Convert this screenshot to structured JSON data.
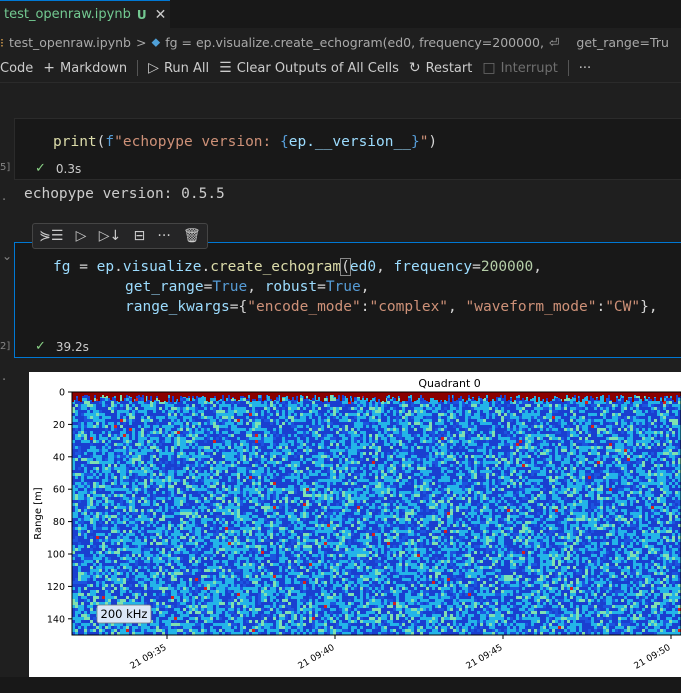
{
  "tab": {
    "name": "test_openraw.ipynb",
    "badge": "U",
    "close": "✕"
  },
  "breadcrumb": {
    "file": "test_openraw.ipynb",
    "sep1": ">",
    "cell": "fg = ep.visualize.create_echogram(ed0, frequency=200000,",
    "wrap": "⏎",
    "rest": "get_range=Tru"
  },
  "toolbar": {
    "code": "Code",
    "markdown": "Markdown",
    "run_all": "Run All",
    "clear": "Clear Outputs of All Cells",
    "restart": "Restart",
    "interrupt": "Interrupt",
    "more": "···"
  },
  "cell1": {
    "gutter": "5]",
    "code_fn": "print",
    "code_p1": "(",
    "code_fprefix": "f",
    "code_str1": "\"echopype version: ",
    "code_brace_open": "{",
    "code_var": "ep.__version__",
    "code_brace_close": "}",
    "code_str2": "\"",
    "code_p2": ")",
    "time": "0.3s",
    "output": "echopype version: 0.5.5",
    "out_gutter": "."
  },
  "cell2": {
    "gutter": "2]",
    "chevron": "⌄",
    "time": "39.2s",
    "out_gutter": ".",
    "line1_var1": "fg",
    "line1_eq": " = ",
    "line1_obj": "ep",
    "line1_dot1": ".",
    "line1_mod": "visualize",
    "line1_dot2": ".",
    "line1_fn": "create_echogram",
    "line1_paren": "(",
    "line1_arg": "ed0",
    "line1_comma": ", ",
    "line1_kw": "frequency",
    "line1_eq2": "=",
    "line1_num": "200000",
    "line1_end": ",",
    "line2_kw1": "get_range",
    "line2_eq1": "=",
    "line2_v1": "True",
    "line2_c": ", ",
    "line2_kw2": "robust",
    "line2_eq2": "=",
    "line2_v2": "True",
    "line2_end": ",",
    "line3_kw": "range_kwargs",
    "line3_eq": "=",
    "line3_ob": "{",
    "line3_s1": "\"encode_mode\"",
    "line3_col1": ":",
    "line3_s2": "\"complex\"",
    "line3_c": ", ",
    "line3_s3": "\"waveform_mode\"",
    "line3_col2": ":",
    "line3_s4": "\"CW\"",
    "line3_cb": "},"
  },
  "cell_toolbar": [
    "⋟☰",
    "▷",
    "▷↓",
    "⊟",
    "···",
    "🗑"
  ],
  "chart_data": {
    "type": "heatmap",
    "title": "Quadrant 0",
    "ylabel": "Range [m]",
    "xlabel": "",
    "ylim": [
      150,
      0
    ],
    "yticks": [
      0,
      20,
      40,
      60,
      80,
      100,
      120,
      140
    ],
    "xticks": [
      "21 09:35",
      "21 09:40",
      "21 09:45",
      "21 09:50"
    ],
    "annotation": "200 kHz",
    "colors": {
      "background": "#1a3fd0",
      "mid": "#23b4e8",
      "high": "#7fe0b0",
      "hot": "#d62020",
      "top": "#8b0000"
    }
  }
}
